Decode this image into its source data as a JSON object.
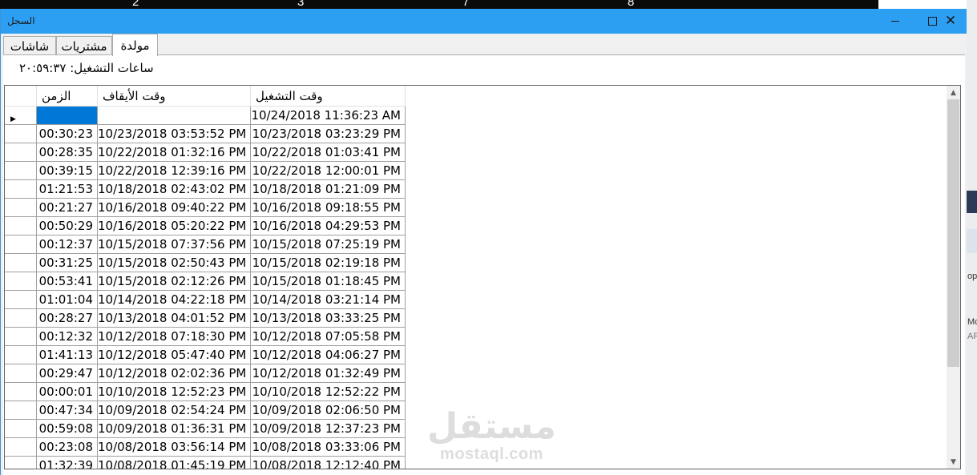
{
  "window": {
    "title": "السجل"
  },
  "background": {
    "top_numbers": [
      "2",
      "3",
      "7",
      "8"
    ],
    "right_fragments": [
      "op",
      "Mc",
      "AR"
    ]
  },
  "tabs": [
    {
      "label": "شاشات",
      "active": false
    },
    {
      "label": "مشتريات",
      "active": false
    },
    {
      "label": "مولدة",
      "active": true
    }
  ],
  "hours_label": "ساعات التشغيل: ٢٠:٥٩:٣٧",
  "grid": {
    "columns": {
      "duration": "الزمن",
      "stop_time": "وقت الأيقاف",
      "start_time": "وقت التشغيل"
    },
    "rows": [
      {
        "duration": "",
        "stop": "",
        "start": "10/24/2018 11:36:23 AM",
        "current": true
      },
      {
        "duration": "00:30:23",
        "stop": "10/23/2018 03:53:52 PM",
        "start": "10/23/2018 03:23:29 PM"
      },
      {
        "duration": "00:28:35",
        "stop": "10/22/2018 01:32:16 PM",
        "start": "10/22/2018 01:03:41 PM"
      },
      {
        "duration": "00:39:15",
        "stop": "10/22/2018 12:39:16 PM",
        "start": "10/22/2018 12:00:01 PM"
      },
      {
        "duration": "01:21:53",
        "stop": "10/18/2018 02:43:02 PM",
        "start": "10/18/2018 01:21:09 PM"
      },
      {
        "duration": "00:21:27",
        "stop": "10/16/2018 09:40:22 PM",
        "start": "10/16/2018 09:18:55 PM"
      },
      {
        "duration": "00:50:29",
        "stop": "10/16/2018 05:20:22 PM",
        "start": "10/16/2018 04:29:53 PM"
      },
      {
        "duration": "00:12:37",
        "stop": "10/15/2018 07:37:56 PM",
        "start": "10/15/2018 07:25:19 PM"
      },
      {
        "duration": "00:31:25",
        "stop": "10/15/2018 02:50:43 PM",
        "start": "10/15/2018 02:19:18 PM"
      },
      {
        "duration": "00:53:41",
        "stop": "10/15/2018 02:12:26 PM",
        "start": "10/15/2018 01:18:45 PM"
      },
      {
        "duration": "01:01:04",
        "stop": "10/14/2018 04:22:18 PM",
        "start": "10/14/2018 03:21:14 PM"
      },
      {
        "duration": "00:28:27",
        "stop": "10/13/2018 04:01:52 PM",
        "start": "10/13/2018 03:33:25 PM"
      },
      {
        "duration": "00:12:32",
        "stop": "10/12/2018 07:18:30 PM",
        "start": "10/12/2018 07:05:58 PM"
      },
      {
        "duration": "01:41:13",
        "stop": "10/12/2018 05:47:40 PM",
        "start": "10/12/2018 04:06:27 PM"
      },
      {
        "duration": "00:29:47",
        "stop": "10/12/2018 02:02:36 PM",
        "start": "10/12/2018 01:32:49 PM"
      },
      {
        "duration": "00:00:01",
        "stop": "10/10/2018 12:52:23 PM",
        "start": "10/10/2018 12:52:22 PM"
      },
      {
        "duration": "00:47:34",
        "stop": "10/09/2018 02:54:24 PM",
        "start": "10/09/2018 02:06:50 PM"
      },
      {
        "duration": "00:59:08",
        "stop": "10/09/2018 01:36:31 PM",
        "start": "10/09/2018 12:37:23 PM"
      },
      {
        "duration": "00:23:08",
        "stop": "10/08/2018 03:56:14 PM",
        "start": "10/08/2018 03:33:06 PM"
      },
      {
        "duration": "01:32:39",
        "stop": "10/08/2018 01:45:19 PM",
        "start": "10/08/2018 12:12:40 PM"
      }
    ]
  },
  "watermark": {
    "arabic": "مستقل",
    "latin": "mostaql.com"
  }
}
